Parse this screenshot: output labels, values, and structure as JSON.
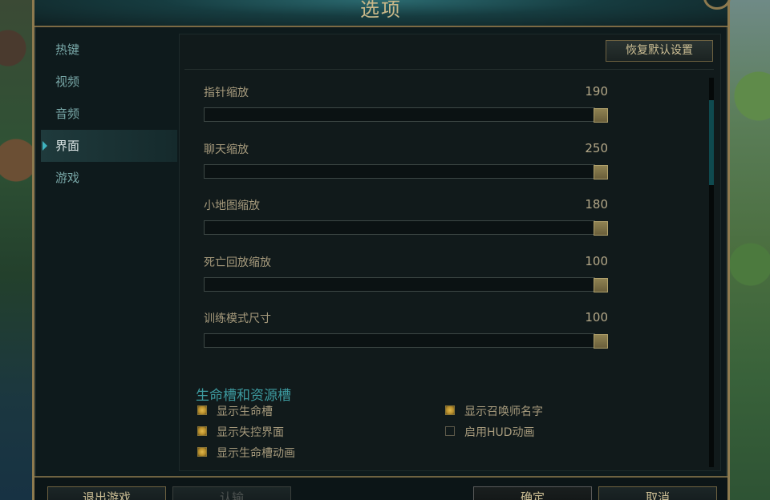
{
  "window": {
    "title": "选项"
  },
  "sidebar": {
    "items": [
      {
        "label": "热键",
        "active": false
      },
      {
        "label": "视频",
        "active": false
      },
      {
        "label": "音频",
        "active": false
      },
      {
        "label": "界面",
        "active": true
      },
      {
        "label": "游戏",
        "active": false
      }
    ]
  },
  "toolbar": {
    "reset_label": "恢复默认设置"
  },
  "sliders": [
    {
      "label": "指针缩放",
      "value": "190",
      "fill_fraction": 1.0
    },
    {
      "label": "聊天缩放",
      "value": "250",
      "fill_fraction": 1.0
    },
    {
      "label": "小地图缩放",
      "value": "180",
      "fill_fraction": 1.0
    },
    {
      "label": "死亡回放缩放",
      "value": "100",
      "fill_fraction": 1.0
    },
    {
      "label": "训练模式尺寸",
      "value": "100",
      "fill_fraction": 1.0
    }
  ],
  "hud_section": {
    "title": "生命槽和资源槽",
    "checkboxes": [
      {
        "label": "显示生命槽",
        "checked": true
      },
      {
        "label": "显示失控界面",
        "checked": true
      },
      {
        "label": "显示生命槽动画",
        "checked": true
      },
      {
        "label": "显示召唤师名字",
        "checked": true
      },
      {
        "label": "启用HUD动画",
        "checked": false
      }
    ]
  },
  "footer": {
    "buttons": [
      {
        "label": "退出游戏",
        "enabled": true
      },
      {
        "label": "认输",
        "enabled": false
      },
      {
        "label": "确定",
        "enabled": true
      },
      {
        "label": "取消",
        "enabled": true
      }
    ]
  },
  "colors": {
    "accent": "#3fb3bf",
    "gold": "#c9b889",
    "checkbox_on": "#e0b84c"
  }
}
